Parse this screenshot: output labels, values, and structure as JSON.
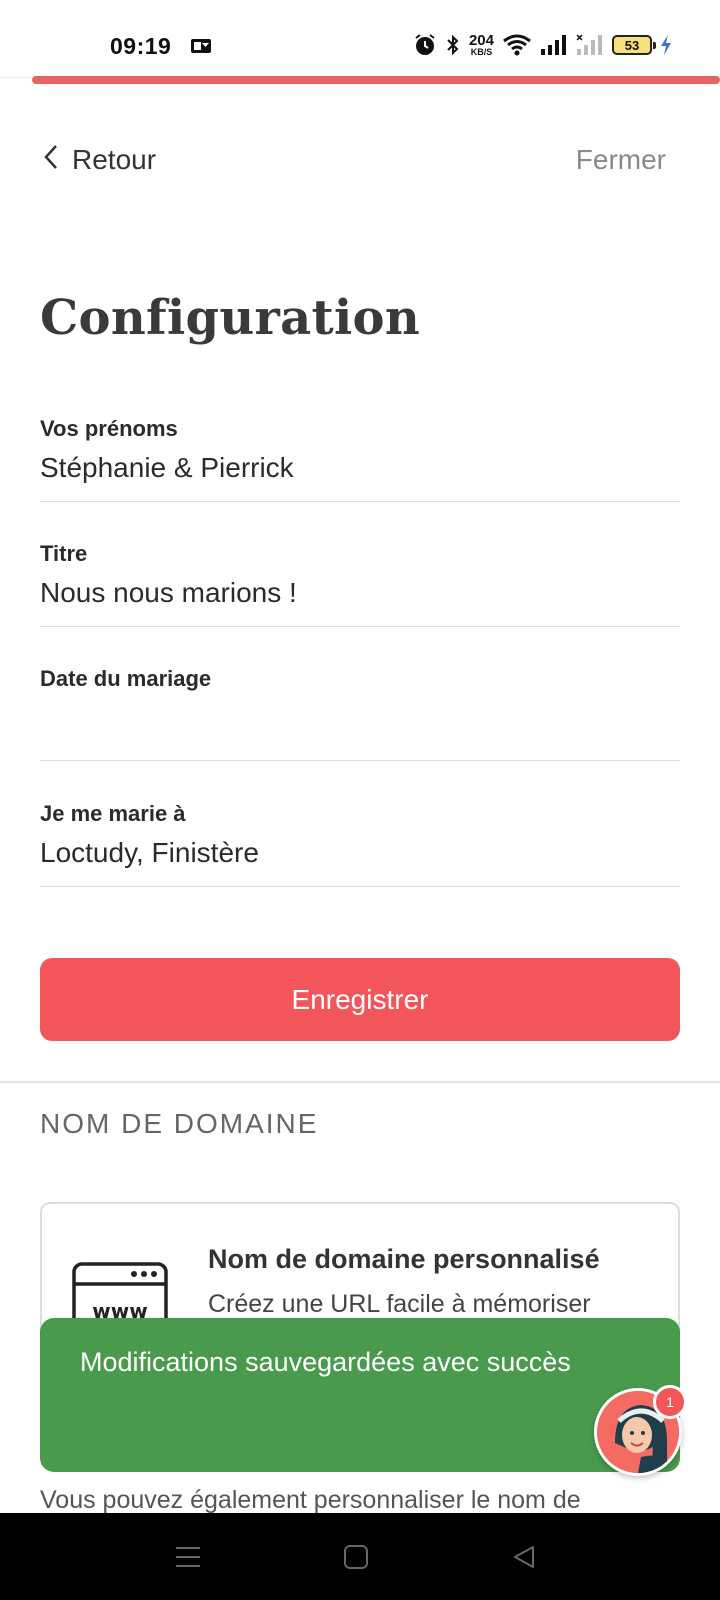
{
  "status_bar": {
    "time": "09:19",
    "net_speed_value": "204",
    "net_speed_unit": "KB/S",
    "battery": "53",
    "icons": [
      "notification-app-icon",
      "alarm-icon",
      "bluetooth-icon",
      "wifi-icon",
      "signal-icon",
      "signal-no-service-icon",
      "battery-icon",
      "charging-icon"
    ]
  },
  "header": {
    "back_label": "Retour",
    "close_label": "Fermer"
  },
  "page": {
    "title": "Configuration"
  },
  "form": {
    "fields": [
      {
        "label": "Vos prénoms",
        "value": "Stéphanie & Pierrick"
      },
      {
        "label": "Titre",
        "value": "Nous nous marions !"
      },
      {
        "label": "Date du mariage",
        "value": ""
      },
      {
        "label": "Je me marie à",
        "value": "Loctudy, Finistère"
      }
    ],
    "save_label": "Enregistrer"
  },
  "domain_section": {
    "heading": "NOM DE DOMAINE",
    "card_title": "Nom de domaine personnalisé",
    "card_description": "Créez une URL facile à mémoriser",
    "icon_text": "www",
    "footer_note": "Vous pouvez également personnaliser le nom de"
  },
  "toast": {
    "message": "Modifications sauvegardées avec succès"
  },
  "chat": {
    "badge_count": "1"
  },
  "colors": {
    "accent": "#f2555a",
    "toast_green": "#4a9a4d",
    "progress": "#e8635f"
  }
}
